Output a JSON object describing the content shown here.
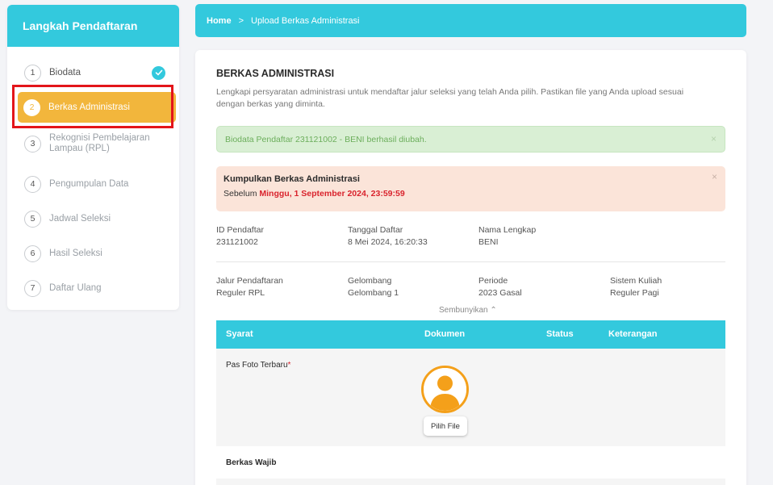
{
  "sidebar": {
    "title": "Langkah Pendaftaran",
    "steps": [
      {
        "num": "1",
        "label": "Biodata"
      },
      {
        "num": "2",
        "label": "Berkas Administrasi"
      },
      {
        "num": "3",
        "label": "Rekognisi Pembelajaran Lampau (RPL)"
      },
      {
        "num": "4",
        "label": "Pengumpulan Data"
      },
      {
        "num": "5",
        "label": "Jadwal Seleksi"
      },
      {
        "num": "6",
        "label": "Hasil Seleksi"
      },
      {
        "num": "7",
        "label": "Daftar Ulang"
      }
    ]
  },
  "breadcrumb": {
    "home": "Home",
    "separator": ">",
    "current": "Upload Berkas Administrasi"
  },
  "card": {
    "title": "BERKAS ADMINISTRASI",
    "description": "Lengkapi persyaratan administrasi untuk mendaftar jalur seleksi yang telah Anda pilih. Pastikan file yang Anda upload sesuai dengan berkas yang diminta."
  },
  "alerts": {
    "success": "Biodata Pendaftar 231121002 - BENI berhasil diubah.",
    "warning_title": "Kumpulkan Berkas Administrasi",
    "warning_prefix": "Sebelum",
    "warning_deadline": "Minggu, 1 September 2024, 23:59:59",
    "close": "×"
  },
  "info": {
    "id_label": "ID Pendaftar",
    "id_value": "231121002",
    "tanggal_label": "Tanggal Daftar",
    "tanggal_value": "8 Mei 2024, 16:20:33",
    "nama_label": "Nama Lengkap",
    "nama_value": "BENI",
    "jalur_label": "Jalur Pendaftaran",
    "jalur_value": "Reguler RPL",
    "gelombang_label": "Gelombang",
    "gelombang_value": "Gelombang 1",
    "periode_label": "Periode",
    "periode_value": "2023 Gasal",
    "sistem_label": "Sistem Kuliah",
    "sistem_value": "Reguler Pagi"
  },
  "hide_link": "Sembunyikan ⌃",
  "table": {
    "headers": [
      "Syarat",
      "Dokumen",
      "Status",
      "Keterangan"
    ],
    "rows": [
      {
        "syarat": "Pas Foto Terbaru",
        "required_mark": "*",
        "button": "Pilih File"
      }
    ],
    "section": "Berkas Wajib"
  },
  "colors": {
    "accent": "#33c9dd",
    "active_step": "#f2b63c",
    "highlight": "#e3151a"
  }
}
